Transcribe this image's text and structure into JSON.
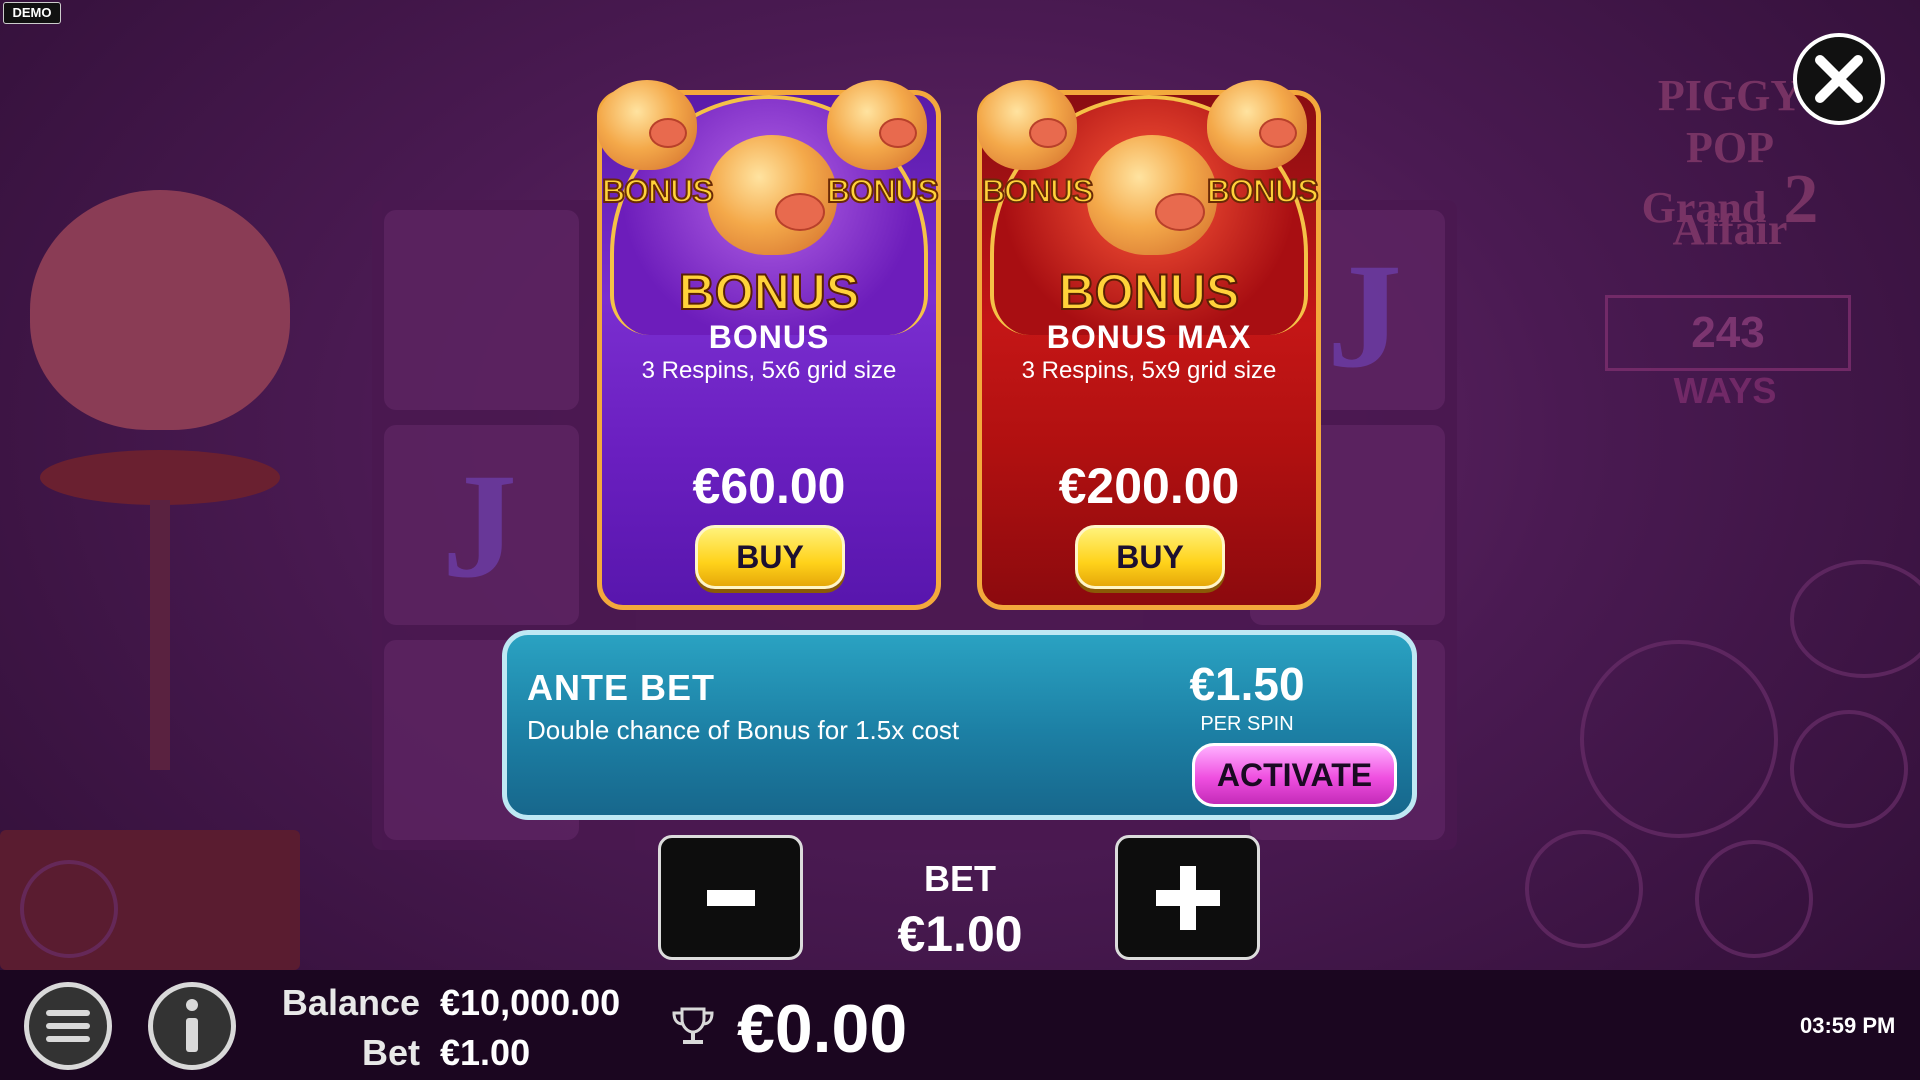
{
  "demo_badge": "DEMO",
  "background": {
    "logo_lines": [
      "PIGGY",
      "POP",
      "Grand",
      "Affair",
      "2"
    ],
    "ways_number": "243",
    "ways_label": "WAYS",
    "reel_letters": [
      "J",
      "J"
    ]
  },
  "bonus_cards": [
    {
      "art_label_small_left": "BONUS",
      "art_label_small_right": "BONUS",
      "art_label_big": "BONUS",
      "title": "BONUS",
      "subtitle": "3 Respins, 5x6 grid size",
      "price": "€60.00",
      "buy_label": "BUY",
      "color": "#6a1fc0"
    },
    {
      "art_label_small_left": "BONUS",
      "art_label_small_right": "BONUS",
      "art_label_big": "BONUS",
      "title": "BONUS MAX",
      "subtitle": "3 Respins, 5x9 grid size",
      "price": "€200.00",
      "buy_label": "BUY",
      "color": "#c41616"
    }
  ],
  "ante_bet": {
    "title": "ANTE BET",
    "description": "Double chance of Bonus for 1.5x cost",
    "price": "€1.50",
    "per_spin": "PER SPIN",
    "activate_label": "ACTIVATE"
  },
  "bet_control": {
    "label": "BET",
    "value": "€1.00",
    "decrease_icon": "minus-icon",
    "increase_icon": "plus-icon"
  },
  "footer": {
    "balance_label": "Balance",
    "balance_value": "€10,000.00",
    "bet_label": "Bet",
    "bet_value": "€1.00",
    "win_value": "€0.00",
    "clock": "03:59 PM",
    "menu_icon": "menu-icon",
    "info_icon": "info-icon",
    "trophy_icon": "trophy-icon"
  },
  "colors": {
    "buy_button": "#ffd21a",
    "activate_button": "#ef4fe0",
    "ante_panel": "#1c7fa4"
  }
}
